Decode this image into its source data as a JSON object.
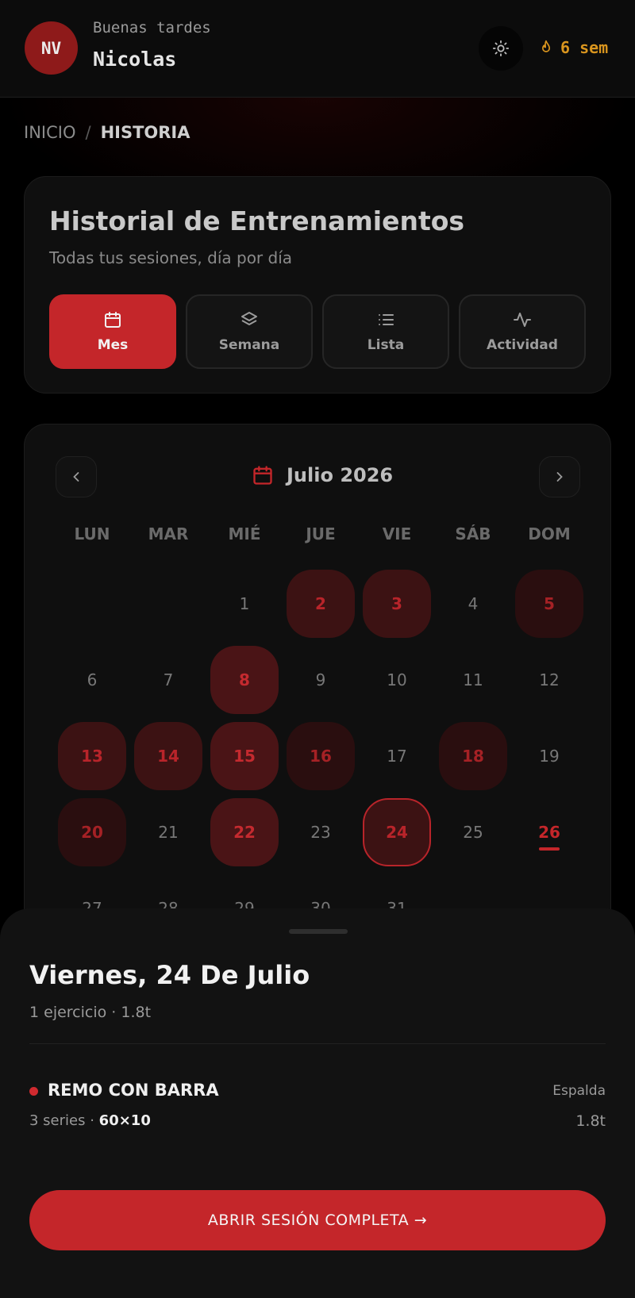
{
  "header": {
    "avatar_initials": "NV",
    "greeting": "Buenas tardes",
    "username": "Nicolas",
    "streak_label": "6 sem",
    "theme_icon": "sun-icon",
    "streak_icon": "flame-icon"
  },
  "breadcrumb": {
    "home": "INICIO",
    "separator": "/",
    "current": "HISTORIA"
  },
  "history": {
    "title": "Historial de Entrenamientos",
    "subtitle": "Todas tus sesiones, día por día",
    "tabs": [
      {
        "label": "Mes",
        "icon": "calendar-icon",
        "active": true
      },
      {
        "label": "Semana",
        "icon": "layers-icon",
        "active": false
      },
      {
        "label": "Lista",
        "icon": "list-icon",
        "active": false
      },
      {
        "label": "Actividad",
        "icon": "activity-icon",
        "active": false
      }
    ]
  },
  "calendar": {
    "month_label": "Julio 2026",
    "weekdays": [
      "LUN",
      "MAR",
      "MIÉ",
      "JUE",
      "VIE",
      "SÁB",
      "DOM"
    ],
    "first_weekday_offset": 2,
    "days_in_month": 31,
    "selected_day": 24,
    "today": 26,
    "workout_intensity": {
      "2": 2,
      "3": 2,
      "5": 1,
      "8": 3,
      "13": 2,
      "14": 2,
      "15": 3,
      "16": 1,
      "18": 1,
      "20": 1,
      "22": 3,
      "24": 2
    }
  },
  "sheet": {
    "title": "Viernes, 24 De Julio",
    "subtitle": "1 ejercicio · 1.8t",
    "exercise": {
      "name": "REMO CON BARRA",
      "muscle": "Espalda",
      "series": "3 series ·",
      "reps": "60×10",
      "volume": "1.8t"
    },
    "open_button": "ABRIR SESIÓN COMPLETA →"
  },
  "colors": {
    "accent": "#c4262a",
    "streak": "#d9951e",
    "background": "#000000"
  }
}
